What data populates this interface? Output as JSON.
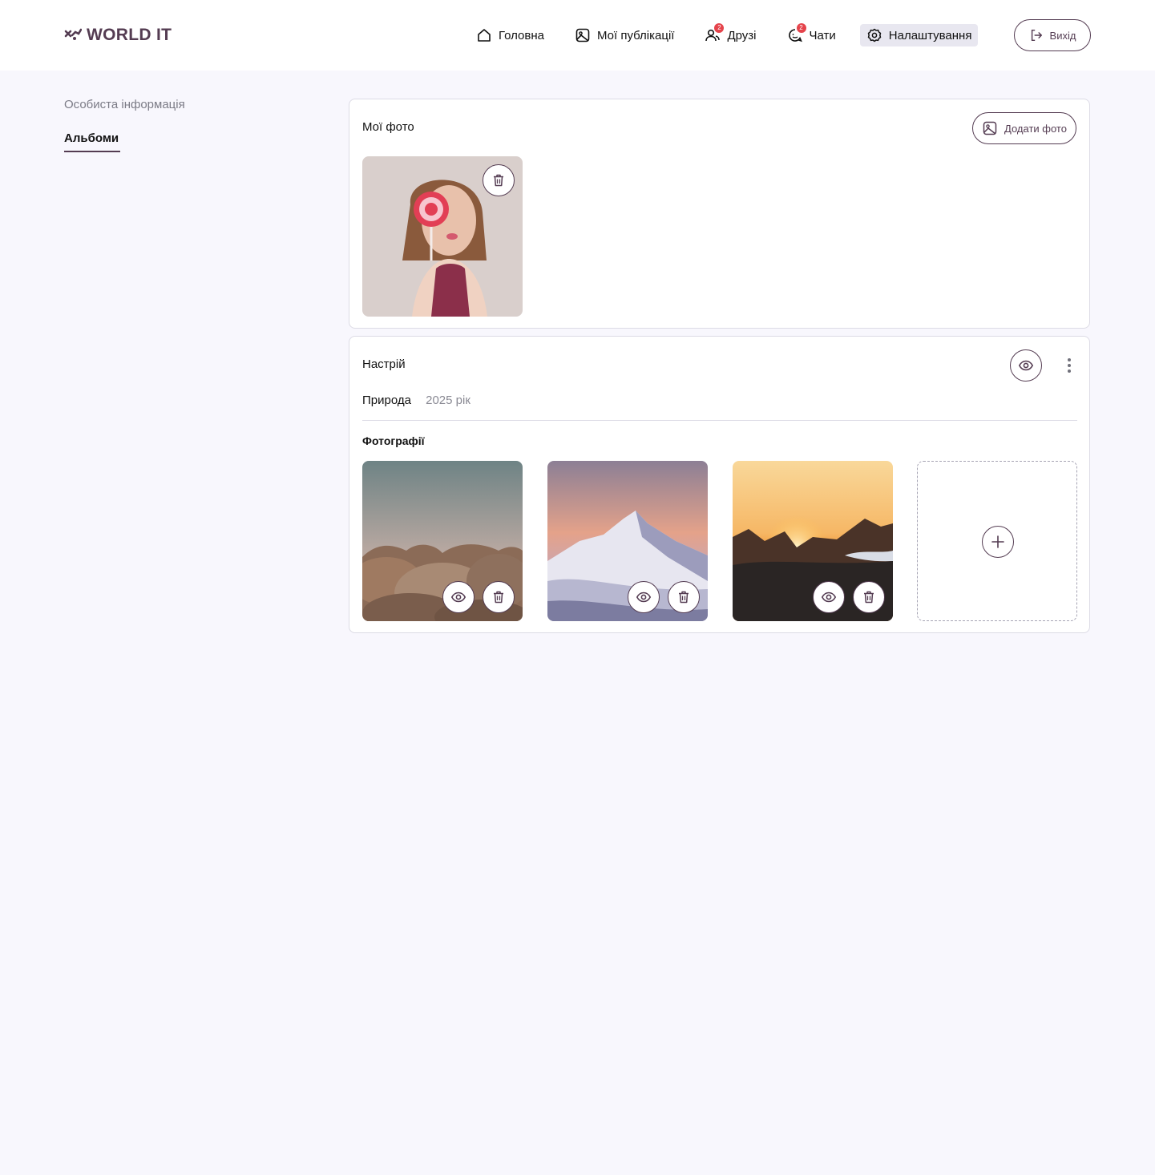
{
  "brand": {
    "name": "WORLD IT",
    "color": "#543c52"
  },
  "nav": {
    "items": [
      {
        "label": "Головна",
        "icon": "home-icon"
      },
      {
        "label": "Мої публікації",
        "icon": "image-icon"
      },
      {
        "label": "Друзі",
        "icon": "users-icon",
        "badge": "2"
      },
      {
        "label": "Чати",
        "icon": "chat-icon",
        "badge": "2"
      },
      {
        "label": "Налаштування",
        "icon": "gear-icon",
        "active": true
      }
    ],
    "logout_label": "Вихід"
  },
  "sidebar": {
    "items": [
      {
        "label": "Особиста інформація"
      },
      {
        "label": "Альбоми",
        "active": true
      }
    ]
  },
  "my_photos": {
    "title": "Мої фото",
    "add_label": "Додати фото"
  },
  "album": {
    "title": "Настрій",
    "tag": "Природа",
    "year": "2025 рік",
    "photos_label": "Фотографії"
  },
  "colors": {
    "accent": "#543c52",
    "badge": "#e5434b",
    "background": "#f8f7fd"
  }
}
